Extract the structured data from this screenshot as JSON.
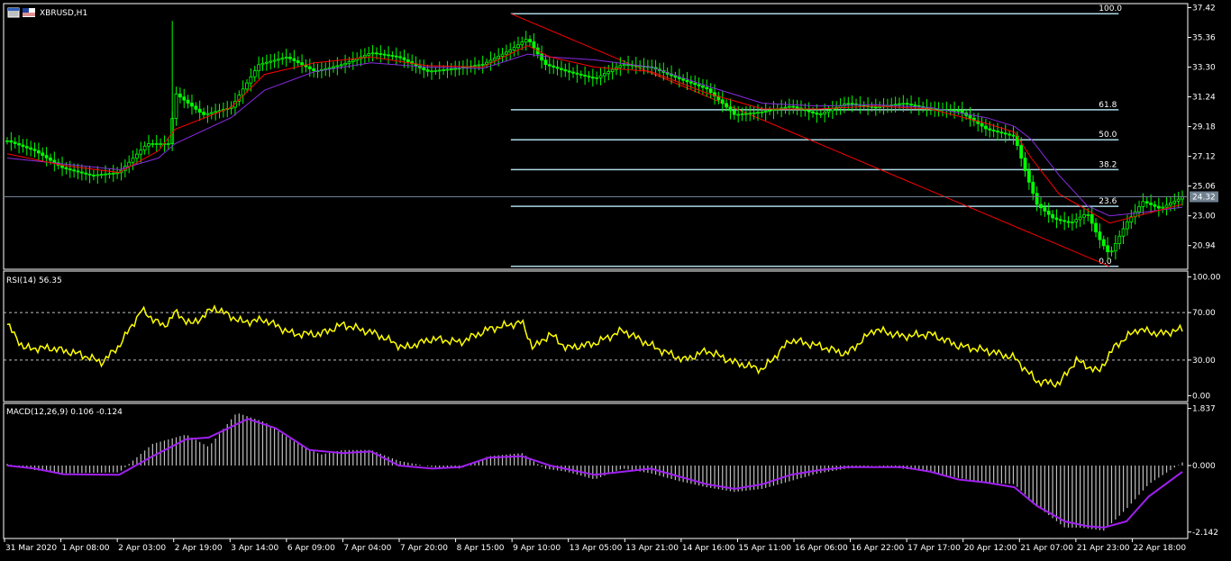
{
  "window": {
    "symbol_title": "XBRUSD,H1",
    "icon": "chart-window-icon"
  },
  "colors": {
    "background": "#000000",
    "border": "#ffffff",
    "candle_up": "#00ff00",
    "candle_down": "#00ff00",
    "ma_fast": "#ff0000",
    "ma_slow": "#8a2be2",
    "fib_levels": "#add8e6",
    "fib_trend": "#ff0000",
    "price_line": "#708090",
    "rsi_line": "#ffff00",
    "macd_hist": "#c0c0c0",
    "macd_signal": "#a020f0"
  },
  "chart_data": [
    {
      "type": "candlestick",
      "title": "XBRUSD,H1",
      "y_ticks": [
        "37.42",
        "35.36",
        "33.30",
        "31.24",
        "29.18",
        "27.12",
        "25.06",
        "23.00",
        "20.94"
      ],
      "ylim": [
        19.3,
        37.7
      ],
      "current_price_label": "24.32",
      "current_price": 24.32,
      "x_categories": [
        "31 Mar 2020",
        "1 Apr 08:00",
        "2 Apr 03:00",
        "2 Apr 19:00",
        "3 Apr 14:00",
        "6 Apr 09:00",
        "7 Apr 04:00",
        "7 Apr 20:00",
        "8 Apr 15:00",
        "9 Apr 10:00",
        "13 Apr 05:00",
        "13 Apr 21:00",
        "14 Apr 16:00",
        "15 Apr 11:00",
        "16 Apr 06:00",
        "16 Apr 22:00",
        "17 Apr 17:00",
        "20 Apr 12:00",
        "21 Apr 07:00",
        "21 Apr 23:00",
        "22 Apr 18:00"
      ],
      "close_path": [
        [
          0,
          28.2
        ],
        [
          0.5,
          27.5
        ],
        [
          1,
          26.3
        ],
        [
          1.5,
          25.8
        ],
        [
          2,
          26.0
        ],
        [
          2.5,
          28.0
        ],
        [
          2.9,
          28.0
        ],
        [
          3.0,
          31.5
        ],
        [
          3.5,
          30.0
        ],
        [
          4,
          30.5
        ],
        [
          4.5,
          33.5
        ],
        [
          5,
          34.0
        ],
        [
          5.5,
          33.0
        ],
        [
          6,
          33.5
        ],
        [
          6.5,
          34.3
        ],
        [
          7,
          34.0
        ],
        [
          7.5,
          33.0
        ],
        [
          8,
          33.2
        ],
        [
          8.5,
          33.5
        ],
        [
          9,
          34.5
        ],
        [
          9.3,
          35.3
        ],
        [
          9.6,
          33.5
        ],
        [
          10,
          33.0
        ],
        [
          10.5,
          32.5
        ],
        [
          11,
          33.5
        ],
        [
          11.5,
          33.3
        ],
        [
          12,
          32.5
        ],
        [
          12.5,
          31.8
        ],
        [
          13,
          30.0
        ],
        [
          13.5,
          30.2
        ],
        [
          14,
          30.6
        ],
        [
          14.5,
          30.0
        ],
        [
          15,
          30.8
        ],
        [
          15.5,
          30.5
        ],
        [
          16,
          30.8
        ],
        [
          16.5,
          30.4
        ],
        [
          17,
          30.3
        ],
        [
          17.5,
          29.0
        ],
        [
          18,
          28.5
        ],
        [
          18.2,
          26.0
        ],
        [
          18.4,
          23.8
        ],
        [
          18.7,
          22.8
        ],
        [
          19,
          22.5
        ],
        [
          19.3,
          23.2
        ],
        [
          19.5,
          21.5
        ],
        [
          19.7,
          20.3
        ],
        [
          20,
          22.5
        ],
        [
          20.3,
          24.0
        ],
        [
          20.6,
          23.5
        ],
        [
          21,
          24.3
        ]
      ],
      "ma_fast_path": [
        [
          0,
          27.3
        ],
        [
          1,
          26.5
        ],
        [
          2,
          26.0
        ],
        [
          2.7,
          27.5
        ],
        [
          3,
          29.0
        ],
        [
          4,
          30.5
        ],
        [
          4.6,
          32.8
        ],
        [
          5.5,
          33.6
        ],
        [
          6.5,
          34.0
        ],
        [
          7.5,
          33.4
        ],
        [
          8.5,
          33.3
        ],
        [
          9.3,
          34.8
        ],
        [
          9.7,
          34.0
        ],
        [
          10.5,
          33.3
        ],
        [
          11.5,
          33.0
        ],
        [
          12.5,
          31.5
        ],
        [
          13.5,
          30.4
        ],
        [
          14.5,
          30.4
        ],
        [
          15.5,
          30.6
        ],
        [
          16.5,
          30.4
        ],
        [
          17.5,
          29.4
        ],
        [
          18,
          28.8
        ],
        [
          18.3,
          27.0
        ],
        [
          18.8,
          24.5
        ],
        [
          19.3,
          23.4
        ],
        [
          19.7,
          22.5
        ],
        [
          20.2,
          23.0
        ],
        [
          21,
          23.8
        ]
      ],
      "ma_slow_path": [
        [
          0,
          27.0
        ],
        [
          1,
          26.6
        ],
        [
          2,
          26.2
        ],
        [
          2.7,
          27.0
        ],
        [
          3,
          28.0
        ],
        [
          4,
          29.8
        ],
        [
          4.6,
          31.7
        ],
        [
          5.5,
          33.0
        ],
        [
          6.5,
          33.6
        ],
        [
          7.5,
          33.3
        ],
        [
          8.5,
          33.2
        ],
        [
          9.3,
          34.2
        ],
        [
          9.7,
          34.0
        ],
        [
          10.5,
          33.8
        ],
        [
          11.5,
          33.3
        ],
        [
          12.5,
          32.0
        ],
        [
          13.5,
          30.8
        ],
        [
          14.5,
          30.6
        ],
        [
          15.5,
          30.7
        ],
        [
          16.5,
          30.5
        ],
        [
          17.5,
          29.8
        ],
        [
          18,
          29.2
        ],
        [
          18.3,
          28.3
        ],
        [
          18.8,
          25.8
        ],
        [
          19.3,
          23.7
        ],
        [
          19.7,
          23.0
        ],
        [
          20.2,
          23.2
        ],
        [
          21,
          23.6
        ]
      ],
      "fibonacci": {
        "start": {
          "x": 9.0,
          "price": 37.0
        },
        "end": {
          "x": 19.7,
          "price": 19.5
        },
        "levels": [
          {
            "label": "100.0",
            "price": 37.0
          },
          {
            "label": "61.8",
            "price": 30.35
          },
          {
            "label": "50.0",
            "price": 28.27
          },
          {
            "label": "38.2",
            "price": 26.2
          },
          {
            "label": "23.6",
            "price": 23.66
          },
          {
            "label": "0.0",
            "price": 19.5
          }
        ]
      }
    },
    {
      "type": "line",
      "title": "RSI(14) 56.35",
      "y_ticks": [
        "100.00",
        "70.00",
        "30.00",
        "0.00"
      ],
      "levels": [
        70,
        30
      ],
      "ylim": [
        -5,
        105
      ],
      "path": [
        [
          0,
          60
        ],
        [
          0.3,
          40
        ],
        [
          0.8,
          40
        ],
        [
          1.3,
          35
        ],
        [
          1.7,
          28
        ],
        [
          2,
          42
        ],
        [
          2.4,
          72
        ],
        [
          2.8,
          58
        ],
        [
          3,
          70
        ],
        [
          3.3,
          60
        ],
        [
          3.7,
          74
        ],
        [
          4.2,
          62
        ],
        [
          4.6,
          64
        ],
        [
          5.1,
          52
        ],
        [
          5.6,
          52
        ],
        [
          6,
          60
        ],
        [
          6.6,
          52
        ],
        [
          7.1,
          40
        ],
        [
          7.6,
          48
        ],
        [
          8.1,
          45
        ],
        [
          8.6,
          56
        ],
        [
          9.2,
          62
        ],
        [
          9.4,
          40
        ],
        [
          9.7,
          52
        ],
        [
          10,
          40
        ],
        [
          10.5,
          44
        ],
        [
          11,
          55
        ],
        [
          11.6,
          40
        ],
        [
          12.1,
          30
        ],
        [
          12.5,
          38
        ],
        [
          13,
          28
        ],
        [
          13.5,
          22
        ],
        [
          14,
          47
        ],
        [
          14.5,
          42
        ],
        [
          15,
          35
        ],
        [
          15.5,
          56
        ],
        [
          16,
          50
        ],
        [
          16.5,
          52
        ],
        [
          17,
          42
        ],
        [
          17.5,
          38
        ],
        [
          18,
          32
        ],
        [
          18.4,
          12
        ],
        [
          18.8,
          10
        ],
        [
          19.1,
          30
        ],
        [
          19.5,
          20
        ],
        [
          19.8,
          42
        ],
        [
          20.2,
          56
        ],
        [
          20.6,
          52
        ],
        [
          21,
          56
        ]
      ]
    },
    {
      "type": "histogram+line",
      "title": "MACD(12,26,9) 0.106 -0.124",
      "y_ticks": [
        "1.837",
        "0.000",
        "-2.142"
      ],
      "ylim": [
        -2.35,
        2.0
      ],
      "hist_path": [
        [
          0,
          0.05
        ],
        [
          0.5,
          -0.15
        ],
        [
          1,
          -0.25
        ],
        [
          2,
          -0.22
        ],
        [
          2.6,
          0.7
        ],
        [
          3.2,
          1.0
        ],
        [
          3.6,
          0.6
        ],
        [
          4.1,
          1.7
        ],
        [
          4.6,
          1.4
        ],
        [
          5.1,
          0.8
        ],
        [
          5.6,
          0.35
        ],
        [
          6,
          0.5
        ],
        [
          6.5,
          0.5
        ],
        [
          7,
          0.15
        ],
        [
          7.6,
          -0.05
        ],
        [
          8.1,
          -0.1
        ],
        [
          8.6,
          0.3
        ],
        [
          9.2,
          0.4
        ],
        [
          9.6,
          -0.1
        ],
        [
          10,
          -0.2
        ],
        [
          10.5,
          -0.45
        ],
        [
          11,
          -0.1
        ],
        [
          11.5,
          -0.25
        ],
        [
          12,
          -0.5
        ],
        [
          12.5,
          -0.7
        ],
        [
          13,
          -0.85
        ],
        [
          13.5,
          -0.75
        ],
        [
          14,
          -0.5
        ],
        [
          14.5,
          -0.25
        ],
        [
          15,
          -0.1
        ],
        [
          15.5,
          0.0
        ],
        [
          16,
          -0.1
        ],
        [
          16.5,
          -0.2
        ],
        [
          17,
          -0.4
        ],
        [
          17.5,
          -0.55
        ],
        [
          18,
          -0.6
        ],
        [
          18.4,
          -1.3
        ],
        [
          18.9,
          -2.0
        ],
        [
          19.2,
          -2.0
        ],
        [
          19.6,
          -2.1
        ],
        [
          20,
          -1.4
        ],
        [
          20.4,
          -0.6
        ],
        [
          21,
          0.1
        ]
      ],
      "signal_path": [
        [
          0,
          0.0
        ],
        [
          0.5,
          -0.1
        ],
        [
          1,
          -0.28
        ],
        [
          2,
          -0.3
        ],
        [
          2.6,
          0.3
        ],
        [
          3.2,
          0.85
        ],
        [
          3.6,
          0.9
        ],
        [
          4.3,
          1.5
        ],
        [
          4.8,
          1.2
        ],
        [
          5.4,
          0.5
        ],
        [
          6,
          0.4
        ],
        [
          6.5,
          0.45
        ],
        [
          7,
          0.0
        ],
        [
          7.6,
          -0.1
        ],
        [
          8.1,
          -0.05
        ],
        [
          8.6,
          0.25
        ],
        [
          9.2,
          0.3
        ],
        [
          9.7,
          0.0
        ],
        [
          10.5,
          -0.3
        ],
        [
          11,
          -0.2
        ],
        [
          11.5,
          -0.1
        ],
        [
          12,
          -0.35
        ],
        [
          12.5,
          -0.6
        ],
        [
          13,
          -0.75
        ],
        [
          13.5,
          -0.6
        ],
        [
          14,
          -0.3
        ],
        [
          14.5,
          -0.15
        ],
        [
          15,
          -0.05
        ],
        [
          15.5,
          -0.05
        ],
        [
          16,
          -0.05
        ],
        [
          16.5,
          -0.2
        ],
        [
          17,
          -0.45
        ],
        [
          17.5,
          -0.55
        ],
        [
          18,
          -0.7
        ],
        [
          18.4,
          -1.3
        ],
        [
          18.9,
          -1.8
        ],
        [
          19.3,
          -1.95
        ],
        [
          19.6,
          -2.0
        ],
        [
          20,
          -1.8
        ],
        [
          20.4,
          -1.0
        ],
        [
          21,
          -0.2
        ]
      ]
    }
  ]
}
